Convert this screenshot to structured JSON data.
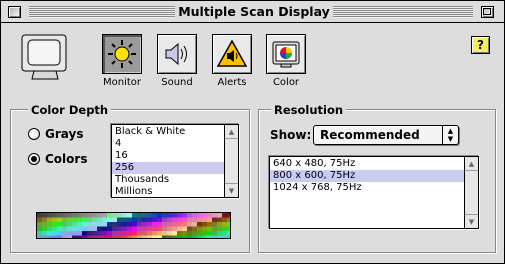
{
  "window": {
    "title": "Multiple Scan Display"
  },
  "toolbar": {
    "items": [
      {
        "label": "Monitor",
        "icon": "sun-icon",
        "active": true
      },
      {
        "label": "Sound",
        "icon": "speaker-icon",
        "active": false
      },
      {
        "label": "Alerts",
        "icon": "alert-triangle-icon",
        "active": false
      },
      {
        "label": "Color",
        "icon": "color-wheel-icon",
        "active": false
      }
    ],
    "help_label": "?"
  },
  "color_depth": {
    "title": "Color Depth",
    "modes": [
      {
        "label": "Grays",
        "selected": false
      },
      {
        "label": "Colors",
        "selected": true
      }
    ],
    "options": [
      "Black & White",
      "4",
      "16",
      "256",
      "Thousands",
      "Millions"
    ],
    "selected": "256"
  },
  "resolution": {
    "title": "Resolution",
    "show_label": "Show:",
    "show_value": "Recommended",
    "options": [
      "640 x 480, 75Hz",
      "800 x 600, 75Hz",
      "1024 x 768, 75Hz"
    ],
    "selected": "800 x 600, 75Hz"
  }
}
